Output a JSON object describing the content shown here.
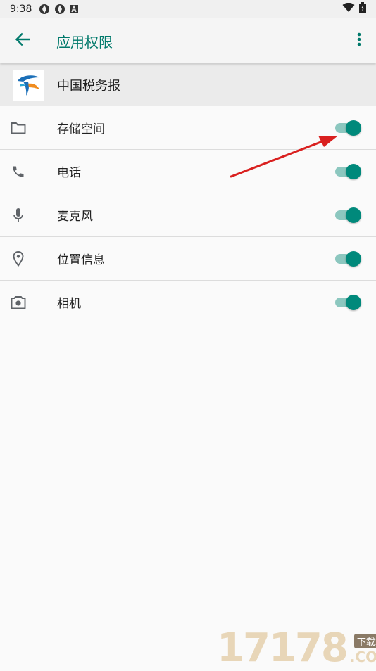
{
  "status_bar": {
    "time": "9:38",
    "icons": [
      "aperture-icon",
      "aperture-icon",
      "text-a-icon"
    ],
    "right_icons": [
      "wifi-icon",
      "battery-charging-icon"
    ]
  },
  "app_bar": {
    "title": "应用权限",
    "back_icon": "arrow-left-icon",
    "menu_icon": "more-vert-icon",
    "accent": "#00796b"
  },
  "app_header": {
    "app_name": "中国税务报"
  },
  "permissions": [
    {
      "label": "存储空间",
      "icon": "folder-icon",
      "enabled": true
    },
    {
      "label": "电话",
      "icon": "phone-icon",
      "enabled": true
    },
    {
      "label": "麦克风",
      "icon": "microphone-icon",
      "enabled": true
    },
    {
      "label": "位置信息",
      "icon": "location-pin-icon",
      "enabled": true
    },
    {
      "label": "相机",
      "icon": "camera-icon",
      "enabled": true
    }
  ],
  "colors": {
    "toggle_on": "#00897b",
    "toggle_track": "#8cc7bf",
    "annotation_arrow": "#d9201f"
  },
  "watermark": {
    "digits": "17178",
    "badge": "下载站",
    "suffix": ".COM"
  }
}
